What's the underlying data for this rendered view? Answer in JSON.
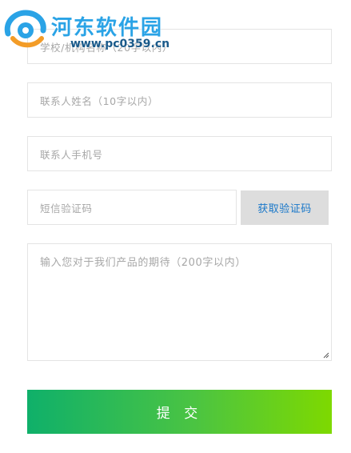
{
  "watermark": {
    "site_name": "河东软件园",
    "url": "www.pc0359.cn"
  },
  "form": {
    "school_placeholder": "学校/机构名称（20字以内）",
    "name_placeholder": "联系人姓名（10字以内）",
    "phone_placeholder": "联系人手机号",
    "sms_code_placeholder": "短信验证码",
    "get_code_button": "获取验证码",
    "expectation_placeholder": "输入您对于我们产品的期待（200字以内）",
    "submit_button": "提 交"
  },
  "colors": {
    "submit_gradient_start": "#0fb06a",
    "submit_gradient_end": "#7ed900",
    "code_button_text": "#1a78c9",
    "code_button_bg": "#dddddd",
    "placeholder_text": "#a7a7a7",
    "watermark_title": "#2aa3e6"
  }
}
